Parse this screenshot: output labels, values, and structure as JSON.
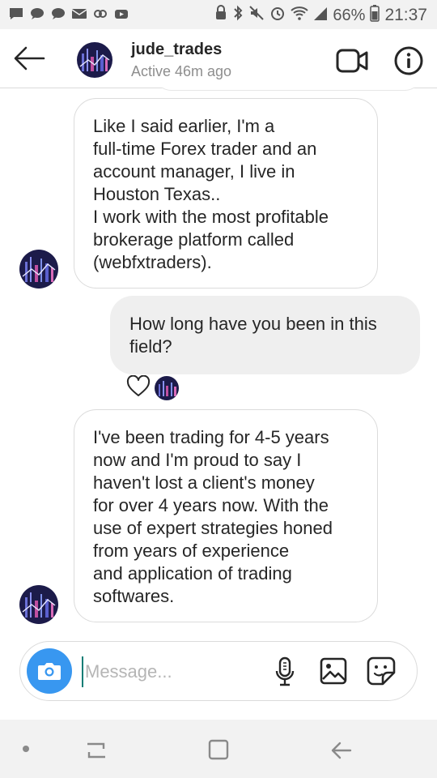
{
  "status_bar": {
    "battery_percent": "66%",
    "time": "21:37",
    "left_icons": [
      "message-icon",
      "chat-bubble-icon",
      "chat-bubble-icon",
      "mail-icon",
      "link-icon",
      "youtube-icon"
    ],
    "right_icons": [
      "alarm-lock-icon",
      "bluetooth-icon",
      "mute-icon",
      "alarm-icon",
      "wifi-icon",
      "signal-icon",
      "battery-icon"
    ]
  },
  "header": {
    "username": "jude_trades",
    "status": "Active 46m ago"
  },
  "messages": [
    {
      "direction": "incoming",
      "text": "Like I said earlier, I'm a\nfull-time Forex trader and an\naccount manager, I live in\nHouston Texas..\nI work with the most profitable\nbrokerage platform called\n(webfxtraders)."
    },
    {
      "direction": "outgoing",
      "text": "How long have you been in this\nfield?"
    },
    {
      "direction": "incoming",
      "text": "I've been trading for 4-5 years\nnow and I'm proud to say I\nhaven't lost a client's money\nfor over 4 years now. With the\nuse of expert strategies honed\nfrom years of experience\nand application of trading\nsoftwares."
    }
  ],
  "composer": {
    "placeholder": "Message..."
  },
  "colors": {
    "camera_button": "#3897f0",
    "outgoing_bubble": "#efefef",
    "incoming_border": "#dbdbdb",
    "cursor": "#0a7d75"
  }
}
